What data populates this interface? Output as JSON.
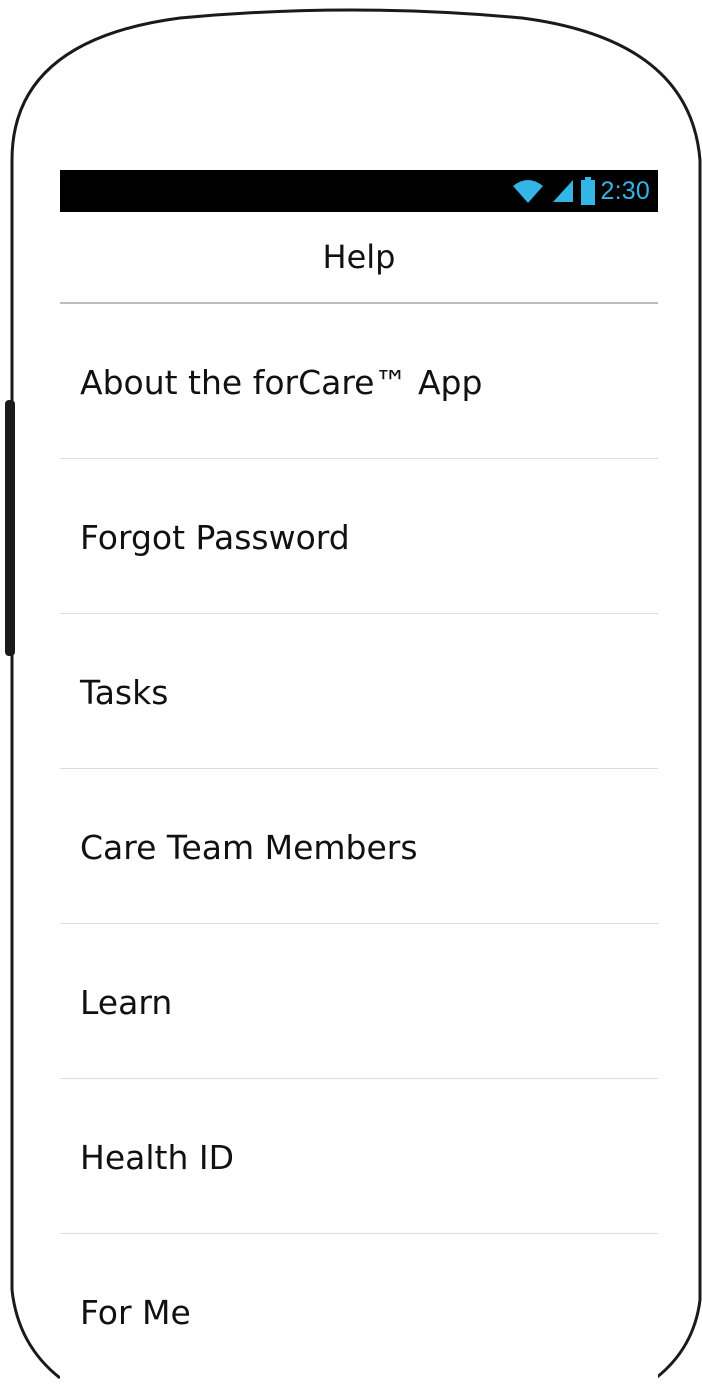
{
  "status_bar": {
    "time": "2:30",
    "icons": [
      "wifi-icon",
      "signal-icon",
      "battery-icon"
    ],
    "accent_color": "#33b5e5"
  },
  "header": {
    "title": "Help"
  },
  "help_items": [
    {
      "label": "About the forCare™ App"
    },
    {
      "label": "Forgot Password"
    },
    {
      "label": "Tasks"
    },
    {
      "label": "Care Team Members"
    },
    {
      "label": "Learn"
    },
    {
      "label": "Health ID"
    },
    {
      "label": "For Me"
    }
  ]
}
